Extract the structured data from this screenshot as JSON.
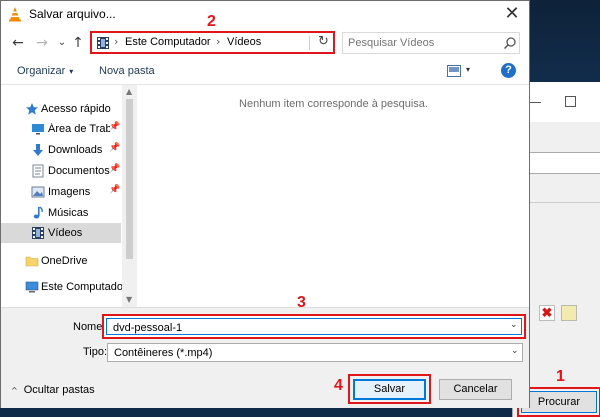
{
  "window": {
    "title": "Salvar arquivo...",
    "close_glyph": "✕"
  },
  "nav": {
    "back_glyph": "←",
    "forward_glyph": "→",
    "recent_glyph": "⌄",
    "up_glyph": "↑",
    "breadcrumb": [
      "Este Computador",
      "Vídeos"
    ],
    "sep_glyph": "›",
    "refresh_glyph": "↻"
  },
  "search": {
    "placeholder": "Pesquisar Vídeos"
  },
  "toolbar": {
    "organize_label": "Organizar",
    "new_folder_label": "Nova pasta",
    "help_glyph": "?",
    "caret_glyph": "▾"
  },
  "sidebar": {
    "items": [
      {
        "label": "Acesso rápido",
        "icon": "star-icon"
      },
      {
        "label": "Área de Trabalho",
        "icon": "desktop-icon",
        "pinned": true
      },
      {
        "label": "Downloads",
        "icon": "download-icon",
        "pinned": true
      },
      {
        "label": "Documentos",
        "icon": "documents-icon",
        "pinned": true
      },
      {
        "label": "Imagens",
        "icon": "images-icon",
        "pinned": true
      },
      {
        "label": "Músicas",
        "icon": "music-icon"
      },
      {
        "label": "Vídeos",
        "icon": "videos-icon",
        "selected": true
      },
      {
        "label": "OneDrive",
        "icon": "onedrive-folder-icon"
      },
      {
        "label": "Este Computador",
        "icon": "computer-icon"
      }
    ],
    "pin_glyph": "📌"
  },
  "main": {
    "empty_message": "Nenhum item corresponde à pesquisa."
  },
  "form": {
    "name_label": "Nome:",
    "name_value": "dvd-pessoal-1",
    "type_label": "Tipo:",
    "type_value": "Contêineres (*.mp4)",
    "dd_glyph": "⌄"
  },
  "footer": {
    "hide_folders_label": "Ocultar pastas",
    "chev_glyph": "^",
    "save_label": "Salvar",
    "cancel_label": "Cancelar"
  },
  "background_window": {
    "browse_label": "Procurar",
    "delete_glyph": "✖"
  },
  "steps": {
    "s1": "1",
    "s2": "2",
    "s3": "3",
    "s4": "4"
  },
  "colors": {
    "annotation_red": "#e0161a",
    "accent_blue": "#0078d7"
  }
}
